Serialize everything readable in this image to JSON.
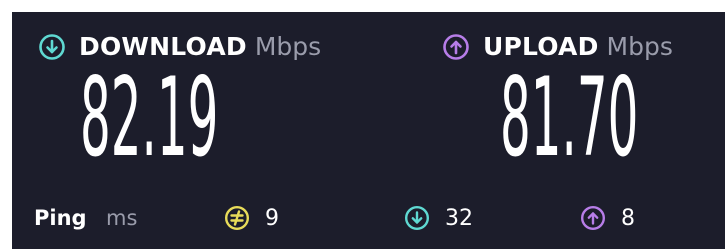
{
  "colors": {
    "background": "#1c1d2b",
    "download_accent": "#5fd9d2",
    "upload_accent": "#b77de8",
    "idle_accent": "#e8dc5a",
    "unit_text": "#9a9cab"
  },
  "download": {
    "icon": "download-arrow-circle-icon",
    "label": "DOWNLOAD",
    "unit": "Mbps",
    "value": "82.19"
  },
  "upload": {
    "icon": "upload-arrow-circle-icon",
    "label": "UPLOAD",
    "unit": "Mbps",
    "value": "81.70"
  },
  "ping": {
    "label": "Ping",
    "unit": "ms",
    "idle": {
      "icon": "idle-latency-icon",
      "value": "9"
    },
    "download": {
      "icon": "download-arrow-circle-icon",
      "value": "32"
    },
    "upload": {
      "icon": "upload-arrow-circle-icon",
      "value": "8"
    }
  }
}
